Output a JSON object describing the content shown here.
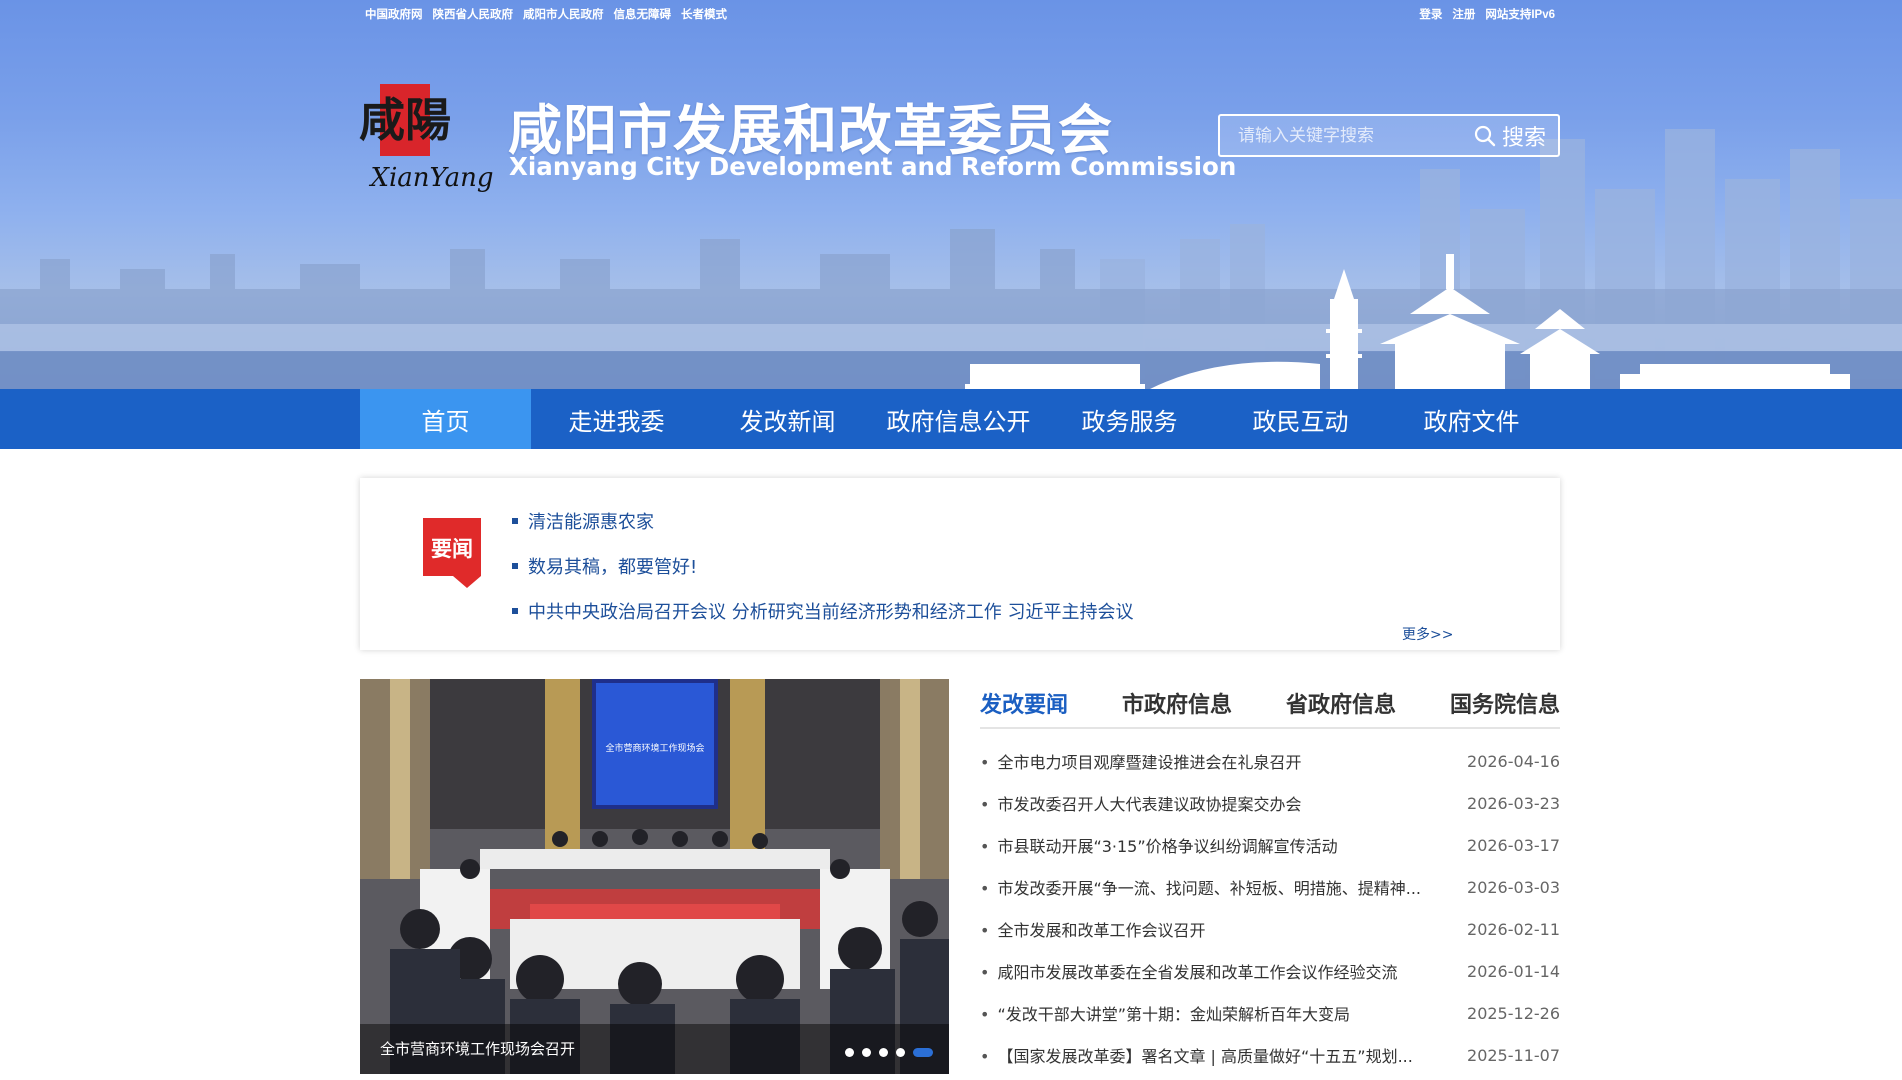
{
  "topbar": {
    "left_links": [
      "中国政府网",
      "陕西省人民政府",
      "咸阳市人民政府",
      "信息无障碍",
      "长者模式"
    ],
    "right_links": [
      "登录",
      "注册",
      "网站支持IPv6"
    ]
  },
  "header": {
    "logo_chars": "咸陽",
    "logo_text": "XianYang",
    "title": "咸阳市发展和改革委员会",
    "subtitle": "Xianyang City Development and Reform Commission"
  },
  "search": {
    "placeholder": "请输入关键字搜索",
    "button_label": "搜索"
  },
  "nav": {
    "items": [
      "首页",
      "走进我委",
      "发改新闻",
      "政府信息公开",
      "政务服务",
      "政民互动",
      "政府文件"
    ],
    "active_index": 0
  },
  "headline": {
    "badge": "要闻",
    "items": [
      "清洁能源惠农家",
      "数易其稿，都要管好!",
      "中共中央政治局召开会议 分析研究当前经济形势和经济工作 习近平主持会议"
    ],
    "more": "更多>>"
  },
  "carousel": {
    "caption": "全市营商环境工作现场会召开",
    "screen_text": "全市营商环境工作现场会",
    "dot_count": 5,
    "active_dot": 4
  },
  "news_tabs": {
    "tabs": [
      "发改要闻",
      "市政府信息",
      "省政府信息",
      "国务院信息"
    ],
    "active_index": 0
  },
  "news_list": [
    {
      "title": "全市电力项目观摩暨建设推进会在礼泉召开",
      "date": "2026-04-16"
    },
    {
      "title": "市发改委召开人大代表建议政协提案交办会",
      "date": "2026-03-23"
    },
    {
      "title": "市县联动开展“3·15”价格争议纠纷调解宣传活动",
      "date": "2026-03-17"
    },
    {
      "title": "市发改委开展“争一流、找问题、补短板、明措施、提精神...",
      "date": "2026-03-03"
    },
    {
      "title": "全市发展和改革工作会议召开",
      "date": "2026-02-11"
    },
    {
      "title": "咸阳市发展改革委在全省发展和改革工作会议作经验交流",
      "date": "2026-01-14"
    },
    {
      "title": "“发改干部大讲堂”第十期：金灿荣解析百年大变局",
      "date": "2025-12-26"
    },
    {
      "title": "【国家发展改革委】署名文章 | 高质量做好“十五五”规划...",
      "date": "2025-11-07"
    }
  ],
  "colors": {
    "nav_bg": "#1b61c6",
    "nav_active": "#3b95f0",
    "badge_red": "#e02a2a",
    "tab_active": "#1b5fc2"
  }
}
